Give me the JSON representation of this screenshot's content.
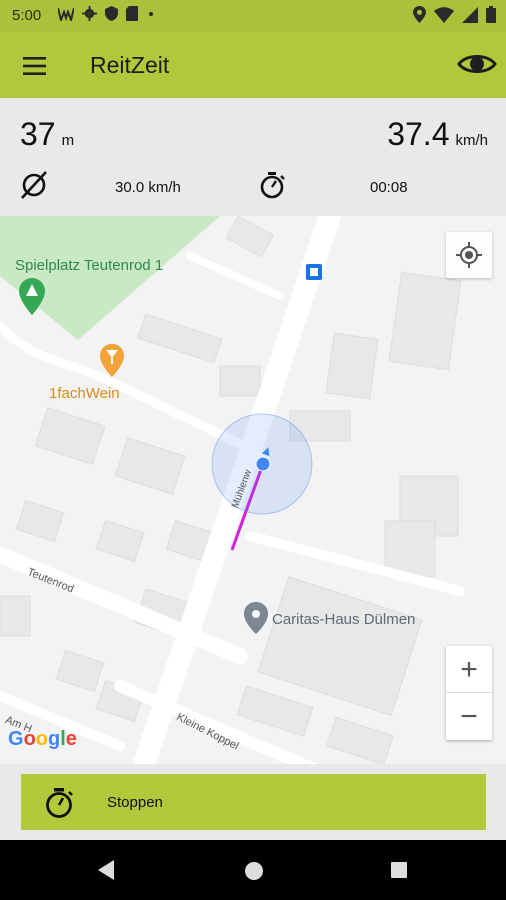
{
  "statusbar": {
    "time": "5:00",
    "left_icons": [
      "w-icon",
      "gear-icon",
      "shield-icon",
      "sd-card-icon",
      "dot-icon"
    ],
    "right_icons": [
      "location-icon",
      "wifi-icon",
      "signal-icon",
      "battery-icon"
    ]
  },
  "appbar": {
    "title": "ReitZeit",
    "menu_icon": "hamburger-menu-icon",
    "eye_icon": "eye-icon",
    "background": "#b2c73b"
  },
  "stats": {
    "distance_value": "37",
    "distance_unit": "m",
    "speed_value": "37.4",
    "speed_unit": "km/h",
    "average_speed": "30.0 km/h",
    "elapsed_time": "00:08"
  },
  "map": {
    "poi_park": "Spielplatz Teutenrod 1",
    "poi_wine": "1fachWein",
    "poi_caritas": "Caritas-Haus Dülmen",
    "street_teutenrod": "Teutenrod",
    "street_kleine_koppel": "Kleine Koppel",
    "street_muhlenweg": "Mühlenw",
    "street_am_h": "Am H",
    "google_logo": "Google",
    "zoom_in": "+",
    "zoom_out": "−",
    "route_color": "#d122d8",
    "location_color": "#4285f4"
  },
  "bottom": {
    "stop_label": "Stoppen",
    "stop_icon": "stopwatch-icon"
  },
  "navbar": {
    "icons": [
      "back-icon",
      "home-icon",
      "recents-icon"
    ]
  }
}
